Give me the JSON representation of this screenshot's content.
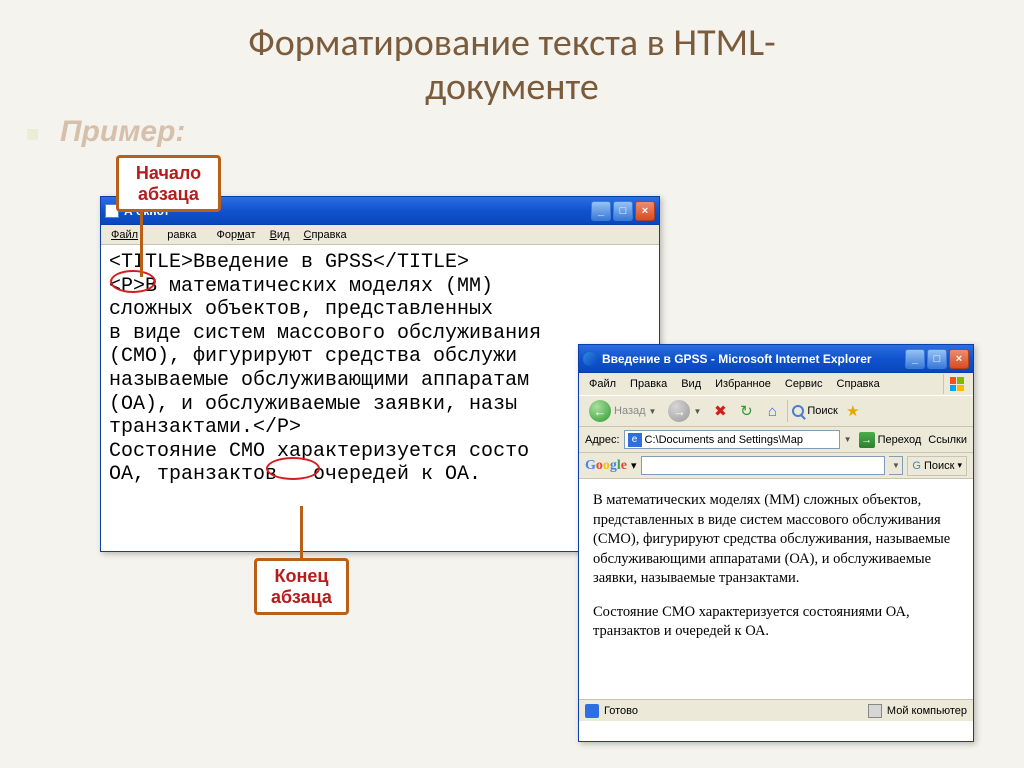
{
  "slide": {
    "title_line1": "Форматирование текста в HTML-",
    "title_line2": "документе",
    "example_label": "Пример:"
  },
  "callouts": {
    "begin_line1": "Начало",
    "begin_line2": "абзаца",
    "end_line1": "Конец",
    "end_line2": "абзаца"
  },
  "notepad": {
    "titlebar": "А               окнот",
    "menu": {
      "file": "Файл",
      "edit": "равка",
      "format": "Формат",
      "view": "Вид",
      "help": "Справка"
    },
    "content": "<TITLE>Введение в GPSS</TITLE>\n<P>В математических моделях (ММ)\nсложных объектов, представленных\nв виде систем массового обслуживания\n(СМО), фигурируют средства обслужи\nназываемые обслуживающими аппаратам\n(ОА), и обслуживаемые заявки, назы\nтранзактами.</P>\nСостояние СМО характеризуется состо\nОА, транзактов   очередей к ОА."
  },
  "ie": {
    "titlebar": "Введение в GPSS - Microsoft Internet Explorer",
    "menu": {
      "file": "Файл",
      "edit": "Правка",
      "view": "Вид",
      "favorites": "Избранное",
      "tools": "Сервис",
      "help": "Справка"
    },
    "toolbar": {
      "back": "Назад",
      "search": "Поиск"
    },
    "address": {
      "label": "Адрес:",
      "value": "C:\\Documents and Settings\\Мар",
      "go": "Переход",
      "links": "Ссылки"
    },
    "google": {
      "search_label": "Поиск"
    },
    "body": {
      "p1": "В математических моделях (ММ) сложных объектов, представленных в виде систем массового обслуживания (СМО), фигурируют средства обслуживания, называемые обслуживающими аппаратами (ОА), и обслуживаемые заявки, называемые транзактами.",
      "p2": "Состояние СМО характеризуется состояниями ОА, транзактов и очередей к ОА."
    },
    "status": {
      "ready": "Готово",
      "zone": "Мой компьютер"
    }
  }
}
